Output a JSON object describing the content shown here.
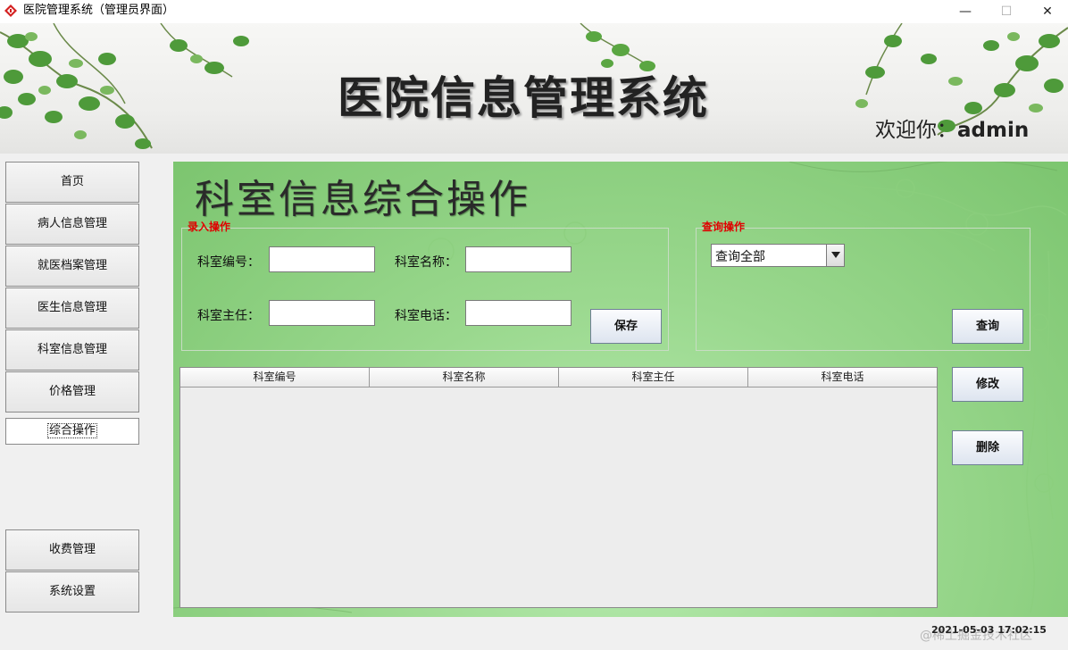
{
  "window": {
    "title": "医院管理系统（管理员界面）",
    "minimize": "—",
    "maximize": "☐",
    "close": "✕"
  },
  "header": {
    "title": "医院信息管理系统",
    "welcome_prefix": "欢迎你：",
    "username": "admin"
  },
  "sidebar": {
    "items": [
      {
        "label": "首页"
      },
      {
        "label": "病人信息管理"
      },
      {
        "label": "就医档案管理"
      },
      {
        "label": "医生信息管理"
      },
      {
        "label": "科室信息管理"
      },
      {
        "label": "价格管理"
      },
      {
        "label": "综合操作",
        "active": true
      },
      {
        "label": "收费管理"
      },
      {
        "label": "系统设置"
      }
    ]
  },
  "main": {
    "title": "科室信息综合操作",
    "entry_group": {
      "legend": "录入操作",
      "dept_id_label": "科室编号：",
      "dept_id_value": "",
      "dept_name_label": "科室名称：",
      "dept_name_value": "",
      "dept_head_label": "科室主任：",
      "dept_head_value": "",
      "dept_phone_label": "科室电话：",
      "dept_phone_value": "",
      "save_button": "保存"
    },
    "query_group": {
      "legend": "查询操作",
      "query_select_value": "查询全部",
      "query_button": "查询"
    },
    "table": {
      "columns": [
        "科室编号",
        "科室名称",
        "科室主任",
        "科室电话"
      ],
      "rows": []
    },
    "edit_button": "修改",
    "delete_button": "删除"
  },
  "status": {
    "datetime": "2021-05-03 17:02:15",
    "watermark": "@稀土掘金技术社区"
  },
  "colors": {
    "legend_red": "#e00000",
    "panel_green": "#9ad88e",
    "button_blue_top": "#fbfcfe",
    "button_blue_bottom": "#dde4ef"
  }
}
